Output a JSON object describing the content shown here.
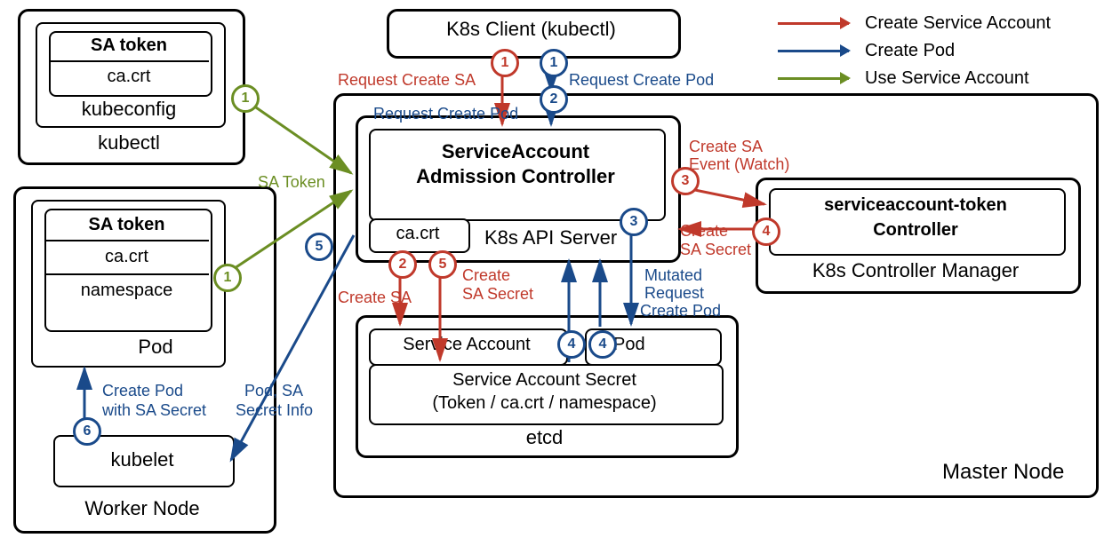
{
  "legend": {
    "create_sa": "Create Service Account",
    "create_pod": "Create Pod",
    "use_sa": "Use Service Account"
  },
  "nodes": {
    "k8s_client": "K8s Client (kubectl)",
    "kubectl_box": {
      "title": "kubectl",
      "kubeconfig": "kubeconfig",
      "sa_token": "SA token",
      "ca_crt": "ca.crt"
    },
    "worker": {
      "title": "Worker Node",
      "pod_title": "Pod",
      "sa_token": "SA token",
      "ca_crt": "ca.crt",
      "namespace": "namespace",
      "kubelet": "kubelet"
    },
    "master": {
      "title": "Master Node",
      "api_server_title": "K8s API Server",
      "admission_ctrl_l1": "ServiceAccount",
      "admission_ctrl_l2": "Admission Controller",
      "ca_crt": "ca.crt",
      "etcd_title": "etcd",
      "etcd_sa": "Service Account",
      "etcd_pod": "Pod",
      "etcd_secret_l1": "Service Account Secret",
      "etcd_secret_l2": "(Token / ca.crt / namespace)",
      "ctrl_mgr_title": "K8s Controller Manager",
      "sat_ctrl_l1": "serviceaccount-token",
      "sat_ctrl_l2": "Controller"
    }
  },
  "edge_labels": {
    "request_create_sa": "Request Create SA",
    "request_create_pod": "Request Create Pod",
    "request_create_pod2": "Request Create Pod",
    "create_sa": "Create SA",
    "create_sa_secret": "Create\nSA Secret",
    "create_sa_secret2": "Create\nSA Secret",
    "create_sa_event_l1": "Create SA",
    "create_sa_event_l2": "Event (Watch)",
    "mutated_req_l1": "Mutated",
    "mutated_req_l2": "Request",
    "mutated_req_l3": "Create Pod",
    "pod_sa_info_l1": "Pod, SA",
    "pod_sa_info_l2": "Secret Info",
    "create_pod_secret_l1": "Create Pod",
    "create_pod_secret_l2": "with SA Secret",
    "sa_token": "SA Token"
  },
  "steps": {
    "red": [
      "1",
      "2",
      "3",
      "4",
      "5"
    ],
    "blue": [
      "1",
      "2",
      "3",
      "4",
      "4",
      "5",
      "6"
    ],
    "olive": [
      "1",
      "1"
    ]
  }
}
